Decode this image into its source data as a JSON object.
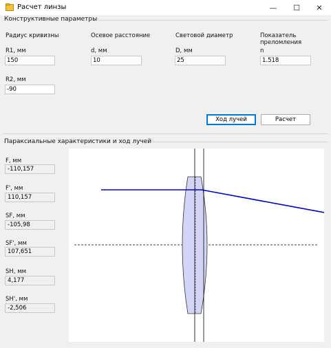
{
  "window": {
    "title": "Расчет линзы",
    "controls": {
      "minimize": "—",
      "maximize": "☐",
      "close": "✕"
    }
  },
  "params_group": {
    "title": "Конструктивные параметры",
    "radius_header": "Радиус кривизны",
    "axial_header": "Осевое расстояние",
    "diameter_header": "Световой диаметр",
    "index_header": "Показатель преломления",
    "r1_label": "R1, мм",
    "r1_value": "150",
    "d_label": "d, мм",
    "d_value": "10",
    "D_label": "D, мм",
    "D_value": "25",
    "n_label": "n",
    "n_value": "1.518",
    "r2_label": "R2, мм",
    "r2_value": "-90",
    "ray_button": "Ход лучей",
    "calc_button": "Расчет"
  },
  "results_group": {
    "title": "Параксиальные характеристики и ход лучей",
    "f_label": "F, мм",
    "f_value": "-110,157",
    "fp_label": "F', мм",
    "fp_value": "110,157",
    "sf_label": "SF, мм",
    "sf_value": "-105,98",
    "sfp_label": "SF', мм",
    "sfp_value": "107,651",
    "sh_label": "SH, мм",
    "sh_value": "4,177",
    "shp_label": "SH', мм",
    "shp_value": "-2,506"
  },
  "colors": {
    "lens_fill": "#d4d4f7",
    "ray": "#0000cc",
    "accent": "#0078d7"
  }
}
